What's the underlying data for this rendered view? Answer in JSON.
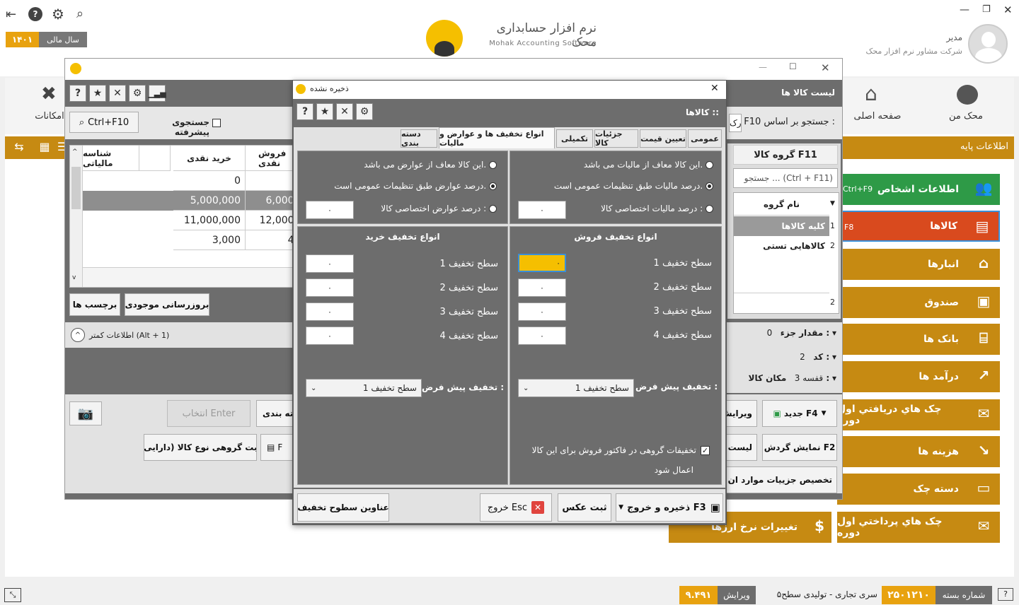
{
  "header": {
    "fiscal_year_label": "سال مالی",
    "fiscal_year_value": "۱۴۰۱",
    "brand_title": "نرم افزار حسابداری محک",
    "brand_subtitle": "Mohak Accounting Software",
    "user_role": "مدیر",
    "user_company": "شرکت مشاور نرم افزار محک"
  },
  "top_nav": {
    "home_label": "صفحه اصلی",
    "my_mohak_label": "محک من",
    "tools_label": "امکانات"
  },
  "section_bar": {
    "label": "اطلاعات پایه"
  },
  "sidebar": [
    {
      "label": "اطلاعات اشخاص",
      "key": "Ctrl+F9",
      "color": "#2e9a47"
    },
    {
      "label": "کالاها",
      "key": "F8",
      "color": "#d94a1e"
    },
    {
      "label": "انبارها",
      "key": "",
      "color": "#c68a12"
    },
    {
      "label": "صندوق",
      "key": "",
      "color": "#c68a12"
    },
    {
      "label": "بانک ها",
      "key": "",
      "color": "#c68a12"
    },
    {
      "label": "درآمد ها",
      "key": "",
      "color": "#c68a12"
    },
    {
      "label": "چک هاي دريافتي اول دوره",
      "key": "",
      "color": "#c68a12"
    },
    {
      "label": "هزينه ها",
      "key": "",
      "color": "#c68a12"
    },
    {
      "label": "دسته چک",
      "key": "",
      "color": "#c68a12"
    },
    {
      "label": "چک هاي پرداختي اول دوره",
      "key": "",
      "color": "#c68a12"
    }
  ],
  "currency_tile": {
    "label": "تغییرات نرخ ارزها"
  },
  "goods_window": {
    "title": "لیست کالا ها",
    "search_key": "Ctrl+F10",
    "advanced_search": "جستجوی پیشرفته",
    "search_basis": "F10 جستجو بر اساس :",
    "search_basis_value": "بارک",
    "columns": [
      "شناسه مالیاتی",
      "خرید نقدی",
      "فروش نقدی"
    ],
    "rows": [
      {
        "buy": "0",
        "sell": ""
      },
      {
        "buy": "5,000,000",
        "sell": "6,000,"
      },
      {
        "buy": "11,000,000",
        "sell": "12,000,"
      },
      {
        "buy": "3,000",
        "sell": "4,"
      }
    ],
    "labels_btn": "برچسب ها",
    "update_stock_btn": "بروزرسانی موجودی",
    "less_info": "اطلاعات کمتر (Alt + 1)",
    "group_header": "گروه کالا F11",
    "group_search": "جستجو ... (Ctrl + F11)",
    "group_col": "نام گروه",
    "groups": [
      {
        "idx": "1",
        "name": "کلیه کالاها"
      },
      {
        "idx": "2",
        "name": "کالاهایی تستی"
      }
    ],
    "group_count": "2",
    "qty_part_label": "مقدار جزء :",
    "qty_part_value": "0",
    "code_label": "کد :",
    "code_value": "2",
    "location_label": "مکان کالا :",
    "location_value": "قفسه 3",
    "select_placeholder": "انتخاب Enter",
    "category_btn": "دسته بندی",
    "group_register_btn": "ثبت گروهی نوع کالا (دارایی)",
    "f_btn": "F",
    "edit_btn": "ویرایش",
    "new_btn": "جدید F4",
    "list_btn": "لیست",
    "show_turnover_btn": "نمایش گردش F2",
    "specialize_btn": "تخصیص جزییات موارد ان"
  },
  "dialog": {
    "title": "ذخیره نشده",
    "section_title": "کالاها",
    "tabs": [
      "عمومی",
      "تعیین قیمت",
      "جزئیات کالا",
      "تکمیلی",
      "انواع تخفیف ها و عوارض و مالیات",
      "دسته بندی"
    ],
    "tax_exempt": "این کالا معاف از مالیات می باشد.",
    "tax_general": "درصد مالیات طبق تنظیمات عمومی است.",
    "tax_custom": "درصد مالیات اختصاصی کالا :",
    "tax_custom_value": "۰",
    "duty_exempt": "این کالا معاف از عوارض می باشد.",
    "duty_general": "درصد عوارض طبق تنظیمات عمومی است.",
    "duty_custom": "درصد عوارض اختصاصی کالا :",
    "duty_custom_value": "۰",
    "sale_discount_title": "انواع تخفیف فروش",
    "buy_discount_title": "انواع تخفیف خرید",
    "levels": [
      "سطح تخفیف 1",
      "سطح تخفیف 2",
      "سطح تخفیف 3",
      "سطح تخفیف 4"
    ],
    "level_value": "۰",
    "default_discount_label": "تخفیف پیش فرض :",
    "default_discount_value": "سطح تخفیف 1",
    "group_discount_text": "تخفیفات گروهی در فاکتور فروش برای این کالا",
    "group_discount_text2": "اعمال شود",
    "save_exit_btn": "ذخیره و خروج F3",
    "photo_btn": "ثبت عکس",
    "exit_btn": "خروج Esc",
    "levels_titles_btn": "عناوین سطوح تخفیف"
  },
  "status_bar": {
    "package_label": "شماره بسته",
    "package_value": "۲۵۰۱۲۱۰",
    "series": "سری تجاری - تولیدی سطح۵",
    "version_label": "ویرایش",
    "version_value": "۹.۴۹۱"
  }
}
